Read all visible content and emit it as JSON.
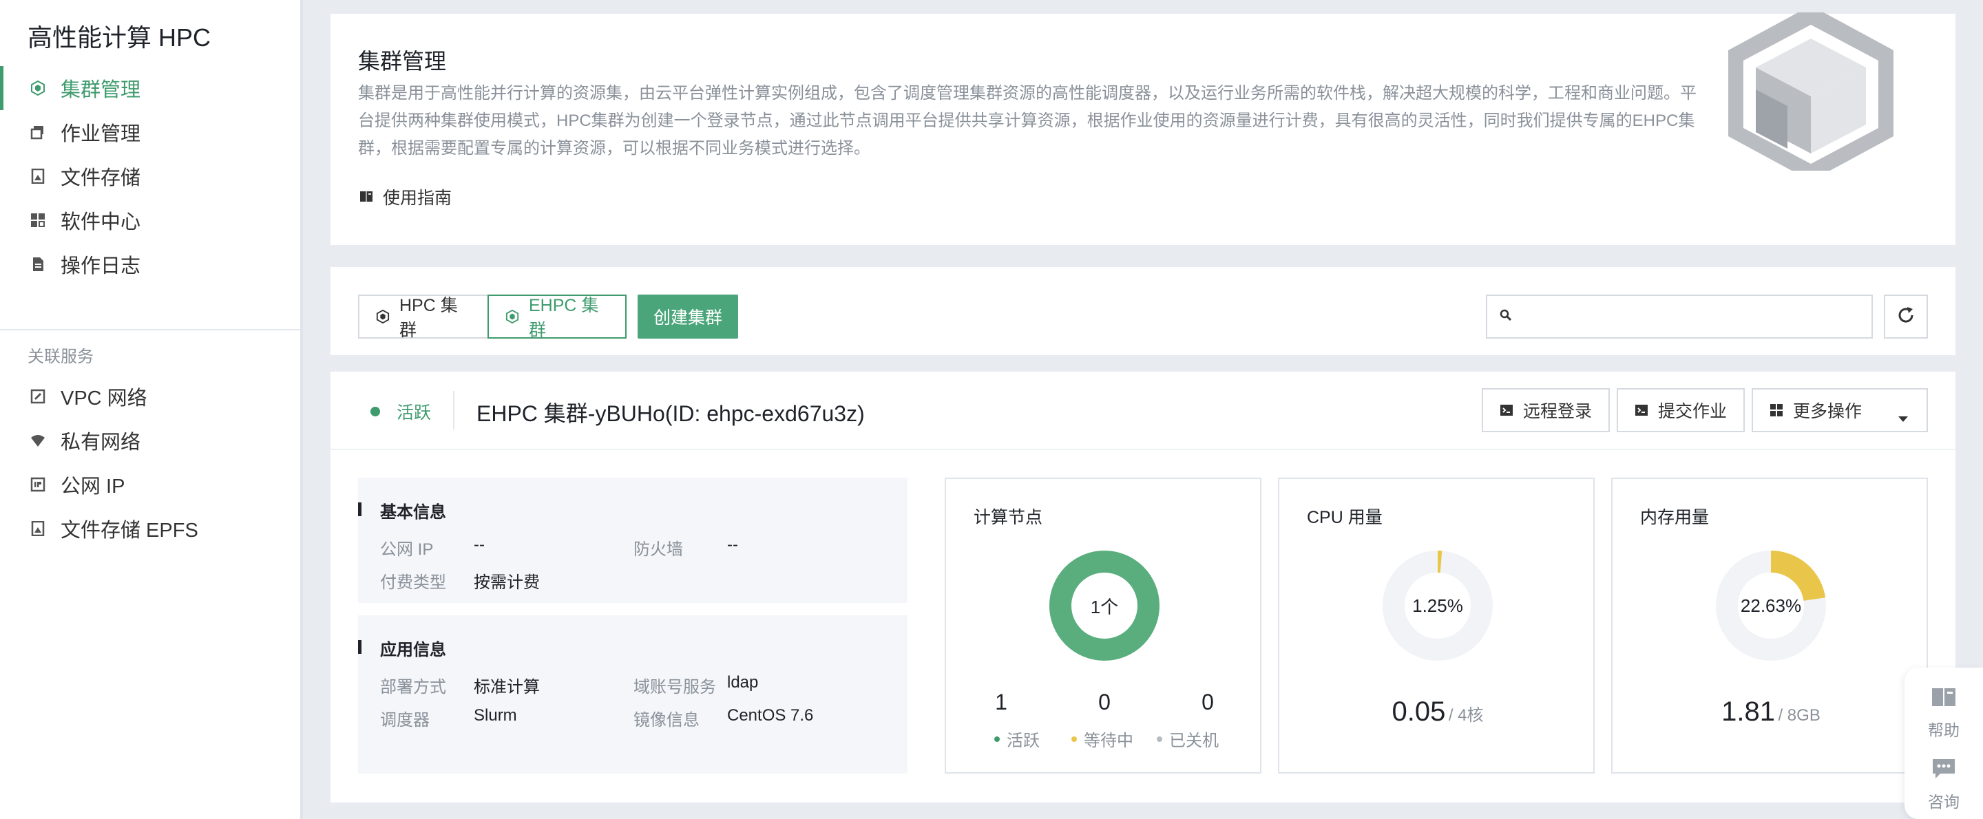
{
  "sidebar": {
    "brand": "高性能计算 HPC",
    "items": [
      {
        "label": "集群管理",
        "icon": "cluster-icon"
      },
      {
        "label": "作业管理",
        "icon": "job-icon"
      },
      {
        "label": "文件存储",
        "icon": "storage-icon"
      },
      {
        "label": "软件中心",
        "icon": "software-icon"
      },
      {
        "label": "操作日志",
        "icon": "log-icon"
      }
    ],
    "related_title": "关联服务",
    "related": [
      {
        "label": "VPC 网络",
        "icon": "vpc-icon"
      },
      {
        "label": "私有网络",
        "icon": "wifi-icon"
      },
      {
        "label": "公网 IP",
        "icon": "ip-icon"
      },
      {
        "label": "文件存储 EPFS",
        "icon": "storage-icon"
      }
    ]
  },
  "intro": {
    "title": "集群管理",
    "description": "集群是用于高性能并行计算的资源集，由云平台弹性计算实例组成，包含了调度管理集群资源的高性能调度器，以及运行业务所需的软件栈，解决超大规模的科学，工程和商业问题。平台提供两种集群使用模式，HPC集群为创建一个登录节点，通过此节点调用平台提供共享计算资源，根据作业使用的资源量进行计费，具有很高的灵活性，同时我们提供专属的EHPC集群，根据需要配置专属的计算资源，可以根据不同业务模式进行选择。",
    "guide": "使用指南"
  },
  "toolbar": {
    "tab_hpc": "HPC 集群",
    "tab_ehpc": "EHPC 集群",
    "create": "创建集群",
    "search_placeholder": ""
  },
  "cluster": {
    "status": "活跃",
    "title": "EHPC 集群-yBUHo(ID: ehpc-exd67u3z)",
    "actions": {
      "remote_login": "远程登录",
      "submit_job": "提交作业",
      "more": "更多操作"
    },
    "basic": {
      "title": "基本信息",
      "public_ip_label": "公网 IP",
      "public_ip": "--",
      "firewall_label": "防火墙",
      "firewall": "--",
      "billing_label": "付费类型",
      "billing": "按需计费"
    },
    "app": {
      "title": "应用信息",
      "deploy_label": "部署方式",
      "deploy": "标准计算",
      "domain_label": "域账号服务",
      "domain": "ldap",
      "scheduler_label": "调度器",
      "scheduler": "Slurm",
      "image_label": "镜像信息",
      "image": "CentOS 7.6"
    },
    "nodes": {
      "title": "计算节点",
      "center": "1个",
      "active": "1",
      "waiting": "0",
      "stopped": "0",
      "active_label": "活跃",
      "waiting_label": "等待中",
      "stopped_label": "已关机",
      "active_fraction": 1.0
    },
    "cpu": {
      "title": "CPU 用量",
      "percent_label": "1.25%",
      "percent": 1.25,
      "value": "0.05",
      "unit": "/ 4核"
    },
    "memory": {
      "title": "内存用量",
      "percent_label": "22.63%",
      "percent": 22.63,
      "value": "1.81",
      "unit": "/ 8GB"
    }
  },
  "float": {
    "help": "帮助",
    "consult": "咨询"
  },
  "colors": {
    "accent": "#3e9b6d",
    "yellow": "#e9c649",
    "gray": "#b5bbc2"
  }
}
